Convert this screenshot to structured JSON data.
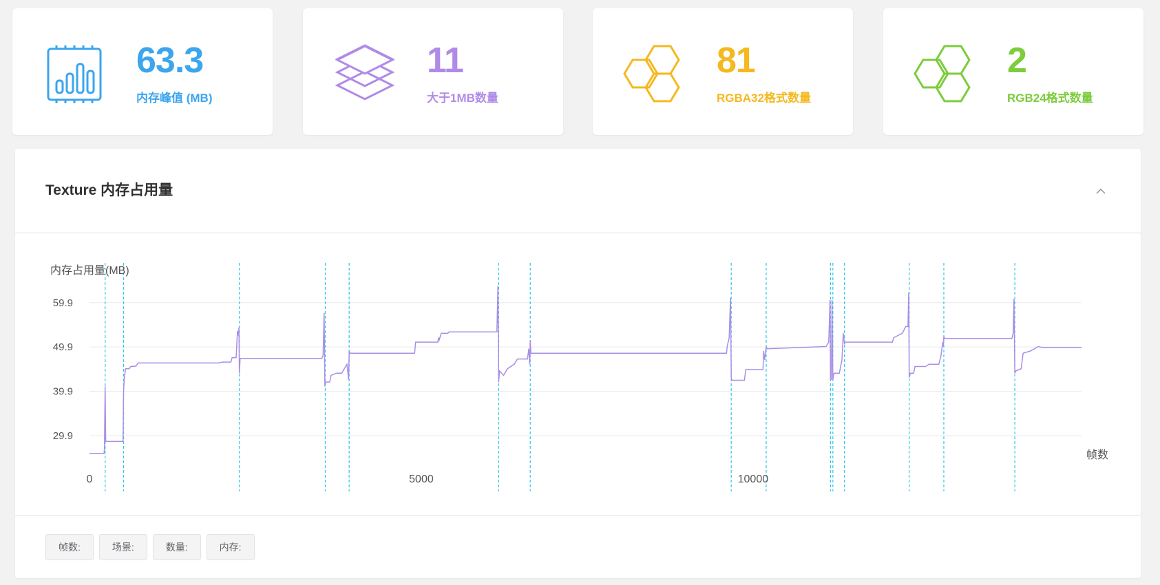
{
  "stats": [
    {
      "value": "63.3",
      "label": "内存峰值 (MB)",
      "color": "#3ba5ee",
      "icon": "memory-chip-icon"
    },
    {
      "value": "11",
      "label": "大于1MB数量",
      "color": "#b08ae8",
      "icon": "layers-icon"
    },
    {
      "value": "81",
      "label": "RGBA32格式数量",
      "color": "#f5b81f",
      "icon": "honeycomb-icon"
    },
    {
      "value": "2",
      "label": "RGB24格式数量",
      "color": "#7ccc3c",
      "icon": "honeycomb-icon"
    }
  ],
  "panel": {
    "title": "Texture 内存占用量"
  },
  "chart_data": {
    "type": "line",
    "ylabel": "内存占用量(MB)",
    "xlabel": "帧数",
    "y_ticks": [
      "59.9",
      "49.9",
      "39.9",
      "29.9"
    ],
    "x_ticks": [
      "0",
      "5000",
      "10000"
    ],
    "xlim": [
      0,
      14950
    ],
    "ylim": [
      25.86,
      66.23
    ],
    "grid": true,
    "line_color": "#a98ee6",
    "marker_color": "#2cc6e8",
    "scene_markers": [
      236,
      514,
      2259,
      3553,
      3913,
      6166,
      6642,
      9671,
      10198,
      11167,
      11203,
      11378,
      12353,
      12875,
      13945
    ],
    "series": [
      {
        "values": [
          [
            0,
            25.9
          ],
          [
            220,
            25.9
          ],
          [
            225,
            27
          ],
          [
            236,
            41
          ],
          [
            245,
            28.6
          ],
          [
            505,
            28.6
          ],
          [
            514,
            40
          ],
          [
            525,
            43
          ],
          [
            545,
            45
          ],
          [
            600,
            45
          ],
          [
            620,
            45.5
          ],
          [
            700,
            45.6
          ],
          [
            730,
            46.3
          ],
          [
            1950,
            46.3
          ],
          [
            2000,
            46.5
          ],
          [
            2130,
            46.5
          ],
          [
            2150,
            47.5
          ],
          [
            2210,
            47.5
          ],
          [
            2220,
            50.5
          ],
          [
            2230,
            53.5
          ],
          [
            2245,
            52.5
          ],
          [
            2252,
            54.3
          ],
          [
            2259,
            44
          ],
          [
            2270,
            47.3
          ],
          [
            3500,
            47.3
          ],
          [
            3520,
            48
          ],
          [
            3536,
            57.6
          ],
          [
            3547,
            41
          ],
          [
            3560,
            42
          ],
          [
            3620,
            42
          ],
          [
            3640,
            43.5
          ],
          [
            3720,
            44
          ],
          [
            3800,
            44
          ],
          [
            3880,
            46
          ],
          [
            3905,
            42.5
          ],
          [
            3913,
            49
          ],
          [
            3925,
            48.5
          ],
          [
            4900,
            48.5
          ],
          [
            4915,
            51
          ],
          [
            5250,
            51
          ],
          [
            5260,
            52
          ],
          [
            5270,
            51.5
          ],
          [
            5300,
            53
          ],
          [
            5400,
            53
          ],
          [
            5420,
            53.3
          ],
          [
            6140,
            53.3
          ],
          [
            6155,
            63.7
          ],
          [
            6166,
            42
          ],
          [
            6180,
            44.5
          ],
          [
            6240,
            43.5
          ],
          [
            6300,
            45
          ],
          [
            6400,
            46
          ],
          [
            6450,
            47.2
          ],
          [
            6600,
            47.2
          ],
          [
            6620,
            49.5
          ],
          [
            6635,
            46
          ],
          [
            6642,
            51.5
          ],
          [
            6652,
            48.5
          ],
          [
            9600,
            48.5
          ],
          [
            9610,
            50
          ],
          [
            9640,
            52
          ],
          [
            9660,
            61
          ],
          [
            9671,
            43
          ],
          [
            9680,
            42.4
          ],
          [
            9870,
            42.4
          ],
          [
            9890,
            44.8
          ],
          [
            10150,
            44.8
          ],
          [
            10160,
            49
          ],
          [
            10175,
            47
          ],
          [
            10198,
            50
          ],
          [
            10210,
            49.5
          ],
          [
            11100,
            50
          ],
          [
            11140,
            51
          ],
          [
            11160,
            60.5
          ],
          [
            11167,
            42.6
          ],
          [
            11180,
            42.6
          ],
          [
            11190,
            60.5
          ],
          [
            11203,
            42.5
          ],
          [
            11220,
            44
          ],
          [
            11300,
            44
          ],
          [
            11340,
            47
          ],
          [
            11360,
            53
          ],
          [
            11378,
            50.5
          ],
          [
            11385,
            51
          ],
          [
            12100,
            51
          ],
          [
            12120,
            52
          ],
          [
            12250,
            53
          ],
          [
            12300,
            54.5
          ],
          [
            12335,
            54.5
          ],
          [
            12346,
            62.2
          ],
          [
            12353,
            43
          ],
          [
            12370,
            44
          ],
          [
            12420,
            44
          ],
          [
            12440,
            45.5
          ],
          [
            12600,
            45.5
          ],
          [
            12650,
            46
          ],
          [
            12800,
            46
          ],
          [
            12830,
            47.8
          ],
          [
            12860,
            51
          ],
          [
            12868,
            50
          ],
          [
            12875,
            52.3
          ],
          [
            12890,
            51.8
          ],
          [
            13900,
            51.8
          ],
          [
            13920,
            53
          ],
          [
            13932,
            60.8
          ],
          [
            13945,
            44
          ],
          [
            13960,
            44.5
          ],
          [
            14040,
            45
          ],
          [
            14070,
            48.5
          ],
          [
            14180,
            49
          ],
          [
            14300,
            50
          ],
          [
            14360,
            49.8
          ],
          [
            14950,
            49.8
          ]
        ]
      }
    ]
  },
  "footer": {
    "tags": [
      "帧数:",
      "场景:",
      "数量:",
      "内存:"
    ]
  }
}
